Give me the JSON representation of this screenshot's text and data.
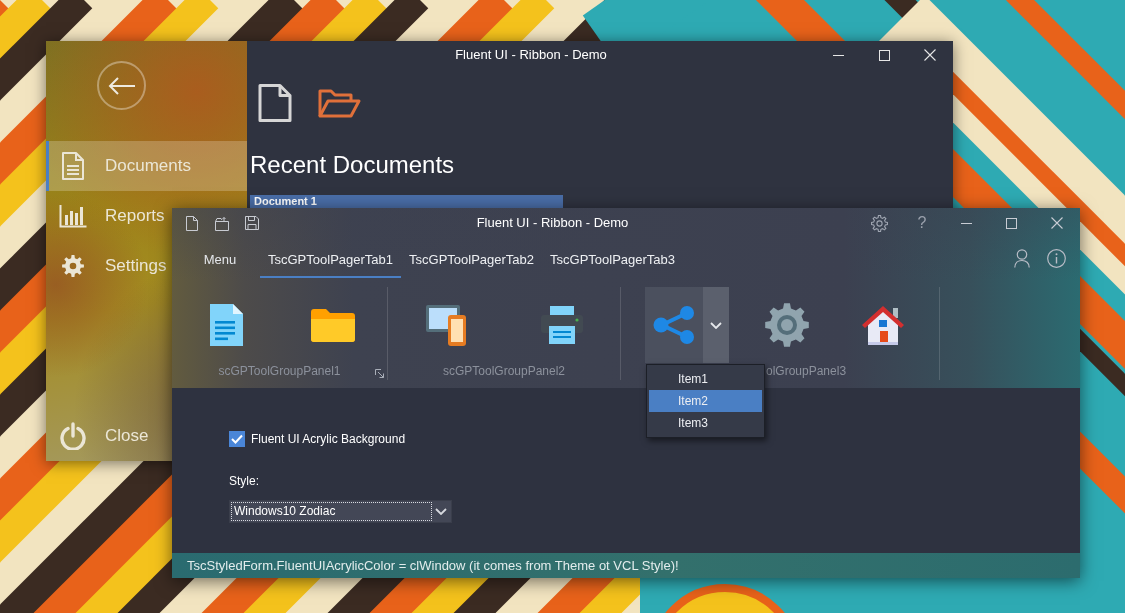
{
  "back_window": {
    "title": "Fluent UI - Ribbon - Demo",
    "sidebar": {
      "items": [
        {
          "label": "Documents",
          "selected": true
        },
        {
          "label": "Reports",
          "selected": false
        },
        {
          "label": "Settings",
          "selected": false
        }
      ],
      "close_item": {
        "label": "Close"
      }
    },
    "heading": "Recent Documents",
    "documents": [
      {
        "label": "Document 1",
        "selected": true
      }
    ]
  },
  "front_window": {
    "title": "Fluent UI - Ribbon - Demo",
    "help_button": "?",
    "menu_button": "Menu",
    "tabs": [
      {
        "label": "TscGPToolPagerTab1",
        "selected": true
      },
      {
        "label": "TscGPToolPagerTab2",
        "selected": false
      },
      {
        "label": "TscGPToolPagerTab3",
        "selected": false
      }
    ],
    "ribbon": {
      "groups": [
        {
          "label": "scGPToolGroupPanel1"
        },
        {
          "label": "scGPToolGroupPanel2"
        },
        {
          "label": "olGroupPanel3",
          "split_button": {
            "expanded": true,
            "menu": [
              {
                "label": "Item1",
                "selected": false
              },
              {
                "label": "Item2",
                "selected": true
              },
              {
                "label": "Item3",
                "selected": false
              }
            ]
          }
        }
      ]
    },
    "acrylic_checkbox": {
      "label": "Fluent UI Acrylic Background",
      "checked": true
    },
    "style_field": {
      "label": "Style:",
      "value": "Windows10 Zodiac"
    },
    "status_bar": "TscStyledForm.FluentUIAcrylicColor = clWindow (it comes from Theme ot VCL Style)!"
  }
}
